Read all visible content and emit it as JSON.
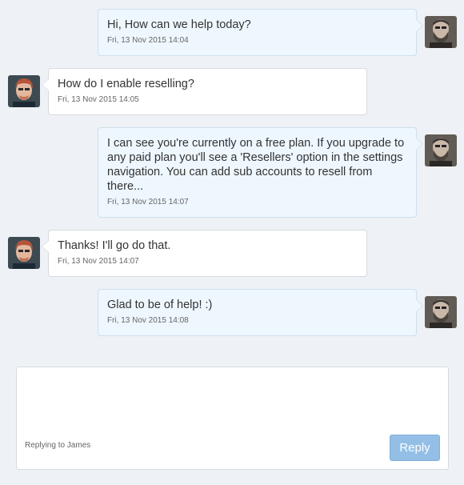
{
  "messages": [
    {
      "role": "agent",
      "text": "Hi, How can we help today?",
      "time": "Fri, 13 Nov 2015 14:04"
    },
    {
      "role": "user",
      "text": "How do I enable reselling?",
      "time": "Fri, 13 Nov 2015 14:05"
    },
    {
      "role": "agent",
      "text": "I can see you're currently on a free plan. If you upgrade to any paid plan you'll see a 'Resellers' option in the settings navigation. You can add sub accounts to resell from there...",
      "time": "Fri, 13 Nov 2015 14:07"
    },
    {
      "role": "user",
      "text": "Thanks! I'll go do that.",
      "time": "Fri, 13 Nov 2015 14:07"
    },
    {
      "role": "agent",
      "text": "Glad to be of help! :)",
      "time": "Fri, 13 Nov 2015 14:08"
    }
  ],
  "reply": {
    "textarea_value": "",
    "replying_to": "Replying to James",
    "button_label": "Reply"
  },
  "colors": {
    "page_background": "#eef1f5",
    "agent_bubble": "#eef7fe",
    "user_bubble": "#ffffff",
    "reply_button": "#93bfe6"
  }
}
